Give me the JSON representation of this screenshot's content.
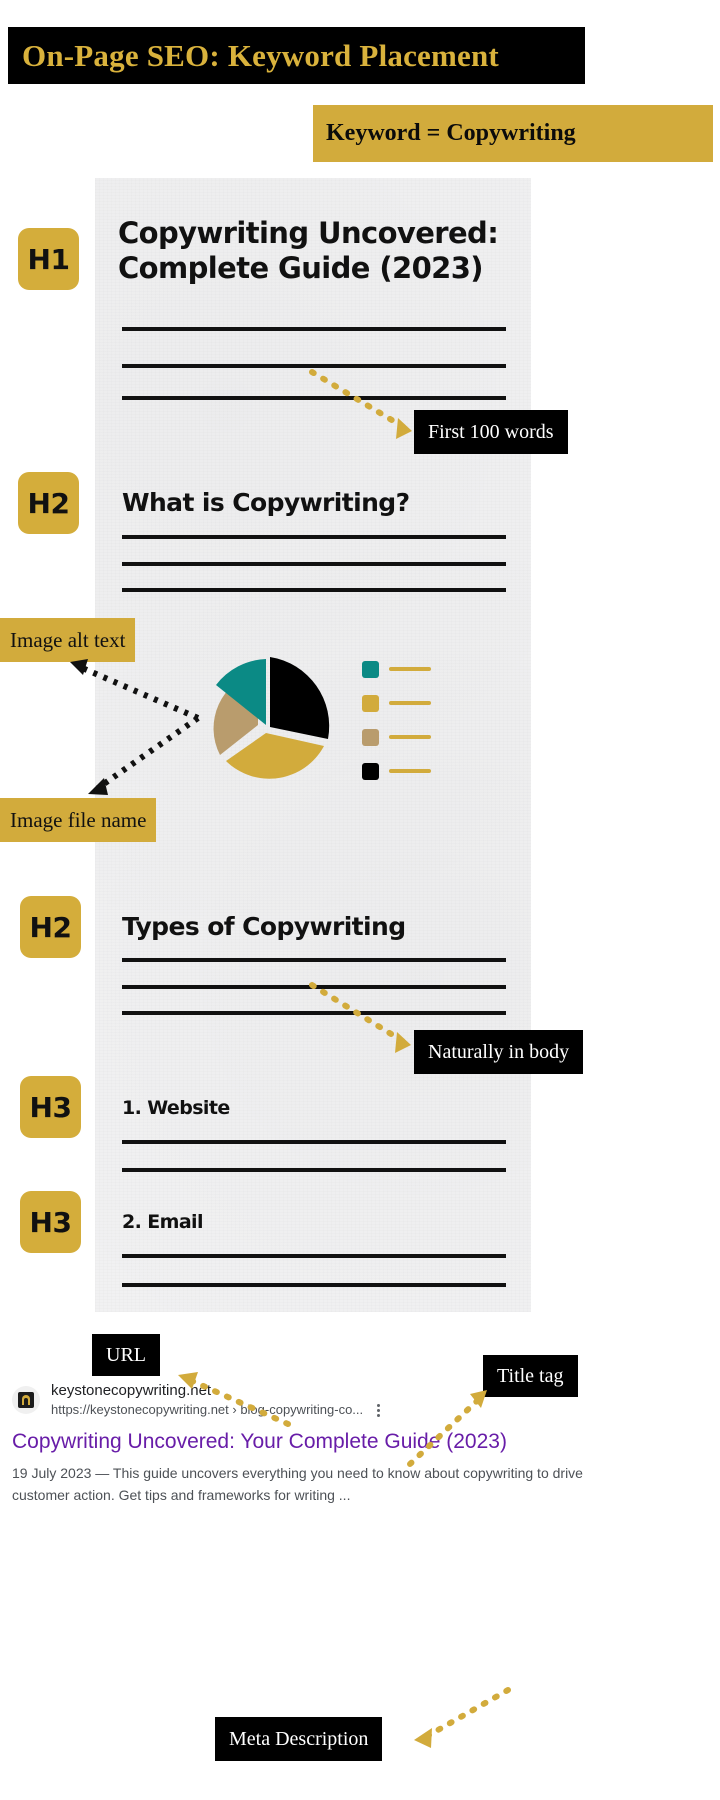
{
  "header": {
    "title": "On-Page SEO: Keyword Placement",
    "keyword_chip": "Keyword = Copywriting",
    "title_bg": "#000000",
    "title_color": "#d9b23c",
    "chip_bg": "#d2ab3c"
  },
  "tags": {
    "h1": "H1",
    "h2_a": "H2",
    "h2_b": "H2",
    "h3_a": "H3",
    "h3_b": "H3",
    "tag_bg": "#d4ad3b"
  },
  "document": {
    "h1": "Copywriting Uncovered: Complete Guide (2023)",
    "h2_what": "What is Copywriting?",
    "h2_types": "Types of Copywriting",
    "h3_website": "1. Website",
    "h3_email": "2. Email"
  },
  "callouts": {
    "first_100_words": "First 100 words",
    "naturally_in_body": "Naturally in body",
    "image_alt_text": "Image alt text",
    "image_file_name": "Image file name",
    "url": "URL",
    "title_tag": "Title tag",
    "meta_description": "Meta Description"
  },
  "serp": {
    "site_name": "keystonecopywriting.net",
    "url": "https://keystonecopywriting.net › blog-copywriting-co...",
    "title": "Copywriting Uncovered: Your Complete Guide (2023)",
    "description": "19 July 2023 — This guide uncovers everything you need to know about copywriting to drive customer action. Get tips and frameworks for writing ...",
    "title_color": "#681da8",
    "menu_icon": "kebab-menu-icon",
    "favicon": "site-favicon"
  },
  "chart_data": {
    "type": "pie",
    "title": "",
    "categories": [
      "Teal segment",
      "Gold segment",
      "Tan segment",
      "Black segment"
    ],
    "values": [
      15,
      30,
      20,
      35
    ],
    "colors": [
      "#0b8a85",
      "#d2ab3c",
      "#b99c6d",
      "#000000"
    ],
    "legend": [
      "",
      "",
      "",
      ""
    ],
    "legend_position": "right",
    "grid": false,
    "exploded": true
  },
  "palette": {
    "gold": "#d2ab3c",
    "teal": "#0b8a85",
    "tan": "#b99c6d",
    "black": "#000000",
    "paper": "#f1f1f2"
  }
}
